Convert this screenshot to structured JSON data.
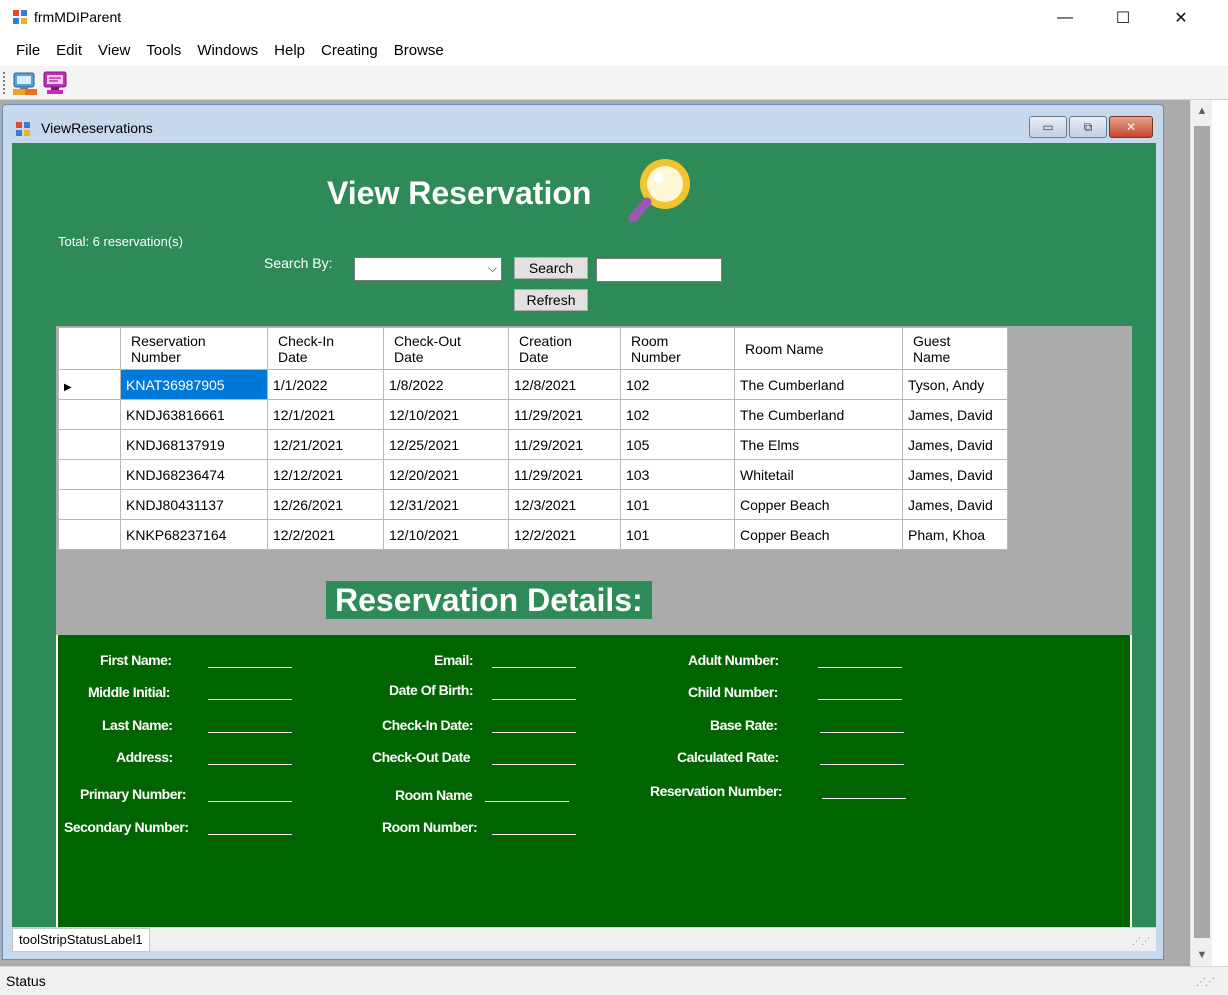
{
  "window": {
    "title": "frmMDIParent",
    "minimize": "—",
    "maximize": "☐",
    "close": "✕"
  },
  "menu": [
    "File",
    "Edit",
    "View",
    "Tools",
    "Windows",
    "Help",
    "Creating",
    "Browse"
  ],
  "toolbar": {
    "icons": [
      "view-reservations-icon",
      "create-reservation-icon"
    ]
  },
  "status_bar": {
    "text": "Status"
  },
  "child_window": {
    "title": "ViewReservations",
    "minimize": "▭",
    "restore": "⧉",
    "close": "✕",
    "status_label": "toolStripStatusLabel1"
  },
  "form": {
    "header": "View Reservation",
    "total_label": "Total: 6 reservation(s)",
    "search_by_label": "Search By:",
    "search_combo_value": "",
    "search_button": "Search",
    "search_text_value": "",
    "refresh_button": "Refresh",
    "details_title": "Reservation Details:"
  },
  "grid": {
    "columns": [
      "Reservation\nNumber",
      "Check-In\nDate",
      "Check-Out\nDate",
      "Creation\nDate",
      "Room\nNumber",
      "Room Name",
      "Guest\nName"
    ],
    "rows": [
      [
        "KNAT36987905",
        "1/1/2022",
        "1/8/2022",
        "12/8/2021",
        "102",
        "The Cumberland",
        "Tyson, Andy"
      ],
      [
        "KNDJ63816661",
        "12/1/2021",
        "12/10/2021",
        "11/29/2021",
        "102",
        "The Cumberland",
        "James, David"
      ],
      [
        "KNDJ68137919",
        "12/21/2021",
        "12/25/2021",
        "11/29/2021",
        "105",
        "The Elms",
        "James, David"
      ],
      [
        "KNDJ68236474",
        "12/12/2021",
        "12/20/2021",
        "11/29/2021",
        "103",
        "Whitetail",
        "James, David"
      ],
      [
        "KNDJ80431137",
        "12/26/2021",
        "12/31/2021",
        "12/3/2021",
        "101",
        "Copper Beach",
        "James, David"
      ],
      [
        "KNKP68237164",
        "12/2/2021",
        "12/10/2021",
        "12/2/2021",
        "101",
        "Copper Beach",
        "Pham, Khoa"
      ]
    ],
    "selected_row": 0,
    "current_row_marker": "▶"
  },
  "details": {
    "first_name": "First Name:",
    "middle_initial": "Middle Initial:",
    "last_name": "Last Name:",
    "address": "Address:",
    "primary_number": "Primary Number:",
    "secondary_number": "Secondary Number:",
    "email": "Email:",
    "date_of_birth": "Date Of Birth:",
    "check_in_date": "Check-In Date:",
    "check_out_date": "Check-Out Date",
    "room_name": "Room Name",
    "room_number": "Room Number:",
    "adult_number": "Adult Number:",
    "child_number": "Child Number:",
    "base_rate": "Base Rate:",
    "calculated_rate": "Calculated Rate:",
    "reservation_number": "Reservation Number:"
  },
  "colors": {
    "form_green": "#2e8b57",
    "details_green": "#006400",
    "selection_blue": "#0078d7",
    "mdi_gray": "#ababab"
  }
}
